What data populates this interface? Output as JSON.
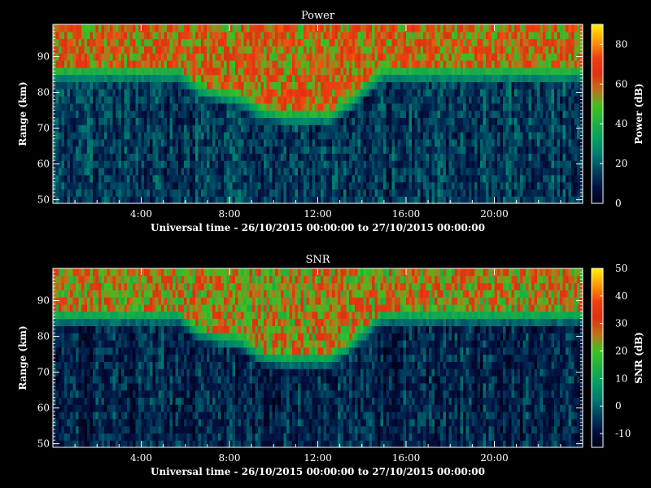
{
  "chart_data": [
    {
      "type": "heatmap",
      "title": "Power",
      "xlabel": "Universal time - 26/10/2015 00:00:00 to 27/10/2015 00:00:00",
      "ylabel": "Range (km)",
      "colorbar_label": "Power (dB)",
      "xlim": [
        "00:00",
        "24:00"
      ],
      "xticks": [
        "4:00",
        "8:00",
        "12:00",
        "16:00",
        "20:00"
      ],
      "ylim": [
        49,
        99
      ],
      "yticks": [
        50,
        60,
        70,
        80,
        90
      ],
      "clim": [
        0,
        90
      ],
      "colorbar_ticks": [
        0,
        20,
        40,
        60,
        80
      ],
      "colormap": [
        "#000018",
        "#001040",
        "#004060",
        "#007a70",
        "#00a060",
        "#1fb040",
        "#40c020",
        "#c07018",
        "#e03010",
        "#ef4010",
        "#ff9a00",
        "#ffee00"
      ],
      "background_level": 15,
      "lower_boundary_km": [
        [
          0,
          84
        ],
        [
          5.8,
          84
        ],
        [
          6.5,
          80
        ],
        [
          7.5,
          78
        ],
        [
          8.5,
          77
        ],
        [
          9.5,
          73
        ],
        [
          10.5,
          72
        ],
        [
          12.5,
          72
        ],
        [
          13.5,
          76
        ],
        [
          14.5,
          82
        ],
        [
          15,
          84
        ],
        [
          24,
          84
        ]
      ],
      "upper_level": 60
    },
    {
      "type": "heatmap",
      "title": "SNR",
      "xlabel": "Universal time - 26/10/2015 00:00:00 to 27/10/2015 00:00:00",
      "ylabel": "Range (km)",
      "colorbar_label": "SNR (dB)",
      "xlim": [
        "00:00",
        "24:00"
      ],
      "xticks": [
        "4:00",
        "8:00",
        "12:00",
        "16:00",
        "20:00"
      ],
      "ylim": [
        49,
        99
      ],
      "yticks": [
        50,
        60,
        70,
        80,
        90
      ],
      "clim": [
        -15,
        50
      ],
      "colorbar_ticks": [
        -10,
        0,
        10,
        20,
        30,
        40,
        50
      ],
      "colormap": [
        "#000018",
        "#001040",
        "#004060",
        "#007a70",
        "#00a060",
        "#1fb040",
        "#40c020",
        "#c07018",
        "#e03010",
        "#ef4010",
        "#ff9a00",
        "#ffee00"
      ],
      "background_level": -7,
      "lower_boundary_km": [
        [
          0,
          84
        ],
        [
          5.8,
          84
        ],
        [
          6.5,
          80
        ],
        [
          7.5,
          78
        ],
        [
          8.5,
          77
        ],
        [
          9.5,
          73
        ],
        [
          10.5,
          72
        ],
        [
          12.5,
          72
        ],
        [
          13.5,
          76
        ],
        [
          14.5,
          82
        ],
        [
          15,
          84
        ],
        [
          24,
          84
        ]
      ],
      "upper_level": 25
    }
  ]
}
